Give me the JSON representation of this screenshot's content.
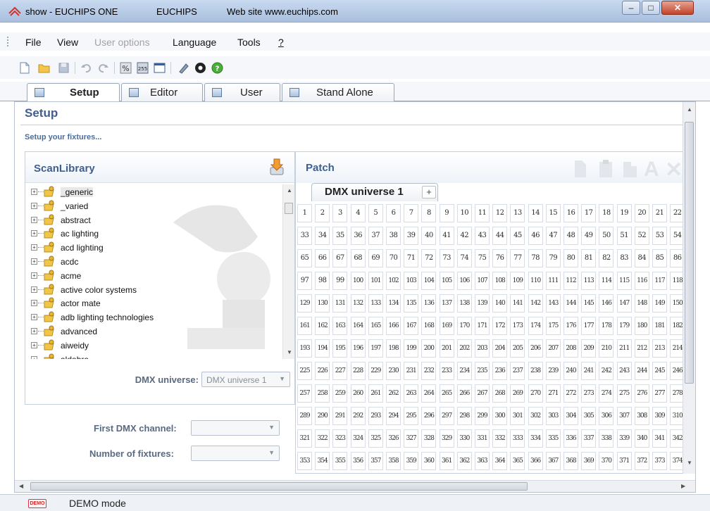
{
  "window": {
    "title_parts": [
      "show - EUCHIPS ONE",
      "EUCHIPS",
      "Web site www.euchips.com"
    ],
    "minimize_glyph": "–",
    "maximize_glyph": "□",
    "close_glyph": "✕"
  },
  "menu": {
    "items": [
      {
        "label": "File",
        "enabled": true
      },
      {
        "label": "View",
        "enabled": true
      },
      {
        "label": "User options",
        "enabled": false
      },
      {
        "label": "Language",
        "enabled": true
      },
      {
        "label": "Tools",
        "enabled": true
      },
      {
        "label": "?",
        "enabled": true
      }
    ]
  },
  "toolbar": {
    "icons": [
      "new-document-icon",
      "open-folder-icon",
      "save-icon",
      "undo-icon",
      "redo-icon",
      "percent-icon",
      "dmx-255-icon",
      "window-icon",
      "pen-icon",
      "record-icon",
      "help-icon"
    ]
  },
  "tabs": [
    {
      "label": "Setup",
      "active": true
    },
    {
      "label": "Editor",
      "active": false
    },
    {
      "label": "User",
      "active": false
    },
    {
      "label": "Stand Alone",
      "active": false
    }
  ],
  "setup": {
    "title": "Setup",
    "subtitle": "Setup your fixtures..."
  },
  "scanlibrary": {
    "title": "ScanLibrary",
    "items": [
      "_generic",
      "_varied",
      "abstract",
      "ac lighting",
      "acd lighting",
      "acdc",
      "acme",
      "active color systems",
      "actor mate",
      "adb lighting technologies",
      "advanced",
      "aiweidy",
      "aldabra"
    ]
  },
  "form": {
    "dmx_universe_label": "DMX universe:",
    "dmx_universe_value": "DMX universe 1",
    "first_channel_label": "First DMX channel:",
    "first_channel_value": "",
    "num_fixtures_label": "Number of fixtures:",
    "num_fixtures_value": ""
  },
  "patch": {
    "title": "Patch",
    "universe_tab": "DMX universe 1",
    "add_tab": "+",
    "columns_visible": 22,
    "rows_visible": 12,
    "start_channel": 1,
    "columns_per_row": 32
  },
  "status": {
    "badge": "DEMO",
    "text": "DEMO mode"
  },
  "colors": {
    "accent_title": "#3f5f8e",
    "titlebar": "#b7cbe6",
    "close_button": "#c2432b"
  }
}
